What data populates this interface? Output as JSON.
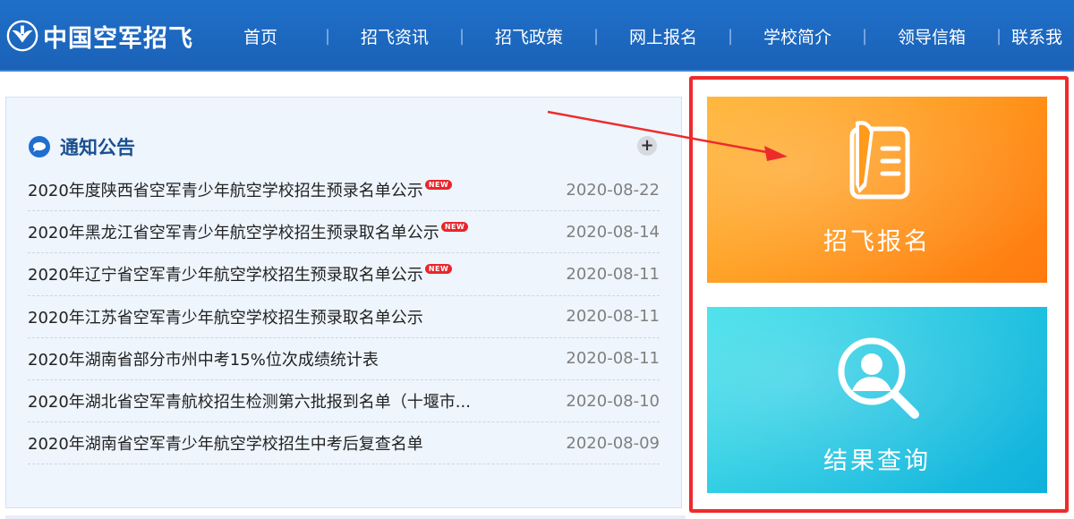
{
  "header": {
    "logo_text": "中国空军招飞",
    "nav": [
      "首页",
      "招飞资讯",
      "招飞政策",
      "网上报名",
      "学校简介",
      "领导信箱",
      "联系我"
    ],
    "separator": "|"
  },
  "notice": {
    "title": "通知公告",
    "more": "+",
    "badge": "NEW",
    "items": [
      {
        "title": "2020年度陕西省空军青少年航空学校招生预录名单公示",
        "date": "2020-08-22",
        "new": true
      },
      {
        "title": "2020年黑龙江省空军青少年航空学校招生预录取名单公示",
        "date": "2020-08-14",
        "new": true
      },
      {
        "title": "2020年辽宁省空军青少年航空学校招生预录取名单公示",
        "date": "2020-08-11",
        "new": true
      },
      {
        "title": "2020年江苏省空军青少年航空学校招生预录取名单公示",
        "date": "2020-08-11",
        "new": false
      },
      {
        "title": "2020年湖南省部分市州中考15%位次成绩统计表",
        "date": "2020-08-11",
        "new": false
      },
      {
        "title": "2020年湖北省空军青航校招生检测第六批报到名单（十堰市...",
        "date": "2020-08-10",
        "new": false
      },
      {
        "title": "2020年湖南省空军青少年航空学校招生中考后复查名单",
        "date": "2020-08-09",
        "new": false
      }
    ]
  },
  "cards": {
    "register": {
      "label": "招飞报名",
      "icon": "pen-form-icon",
      "color": "#ff9a1b"
    },
    "query": {
      "label": "结果查询",
      "icon": "search-user-icon",
      "color": "#27c8e2"
    }
  },
  "colors": {
    "header_bg": "#1b62b8",
    "annotation_red": "#ee2b2b"
  }
}
